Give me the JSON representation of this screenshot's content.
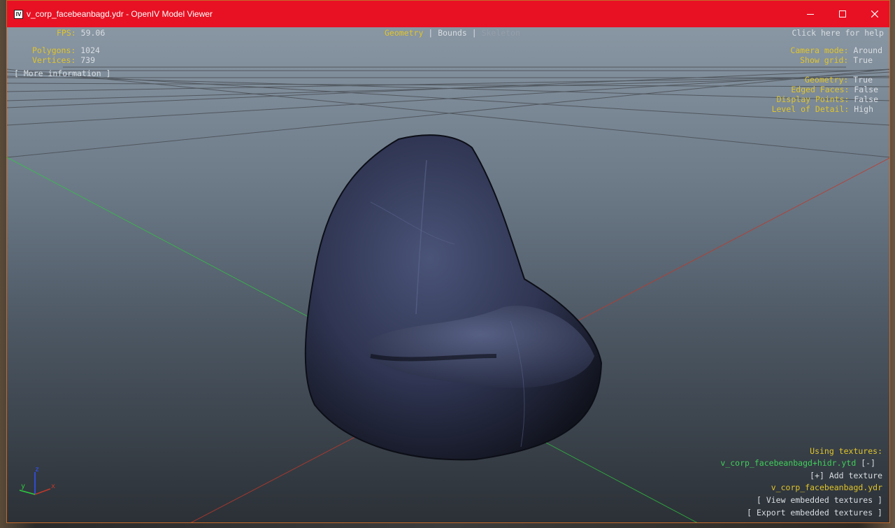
{
  "window": {
    "title": "v_corp_facebeanbagd.ydr - OpenIV Model Viewer",
    "icon_text": "IV",
    "controls": [
      "minimize-icon",
      "maximize-icon",
      "close-icon"
    ]
  },
  "stats": {
    "fps_label": "FPS:",
    "fps_value": "59.06",
    "polygons_label": "Polygons:",
    "polygons_value": "1024",
    "vertices_label": "Vertices:",
    "vertices_value": "739",
    "more_info": "[ More information ]"
  },
  "modes": {
    "geometry": "Geometry",
    "sep1": "|",
    "bounds": "Bounds",
    "sep2": "|",
    "skeleton": "Skeleton"
  },
  "help": "Click here for help",
  "settings": {
    "camera_label": "Camera mode:",
    "camera_value": "Around",
    "grid_label": "Show grid:",
    "grid_value": "True",
    "geometry_label": "Geometry:",
    "geometry_value": "True",
    "edged_label": "Edged Faces:",
    "edged_value": "False",
    "points_label": "Display Points:",
    "points_value": "False",
    "lod_label": "Level of Detail:",
    "lod_value": "High"
  },
  "textures": {
    "heading": "Using textures:",
    "file1": "v_corp_facebeanbagd+hidr.ytd",
    "remove": "[-]",
    "add": "[+] Add texture",
    "file2": "v_corp_facebeanbagd.ydr",
    "view_embedded": "[ View embedded textures ]",
    "export_embedded": "[ Export embedded textures ]"
  },
  "axes": {
    "x": "x",
    "y": "y",
    "z": "z"
  },
  "colors": {
    "titlebar": "#e81123",
    "label_yellow": "#e0c52a",
    "value_white": "#d8dde2",
    "texture_green": "#3fcf5a",
    "axis_x": "#c0392b",
    "axis_y": "#2ecc40",
    "axis_z": "#3050ff"
  }
}
